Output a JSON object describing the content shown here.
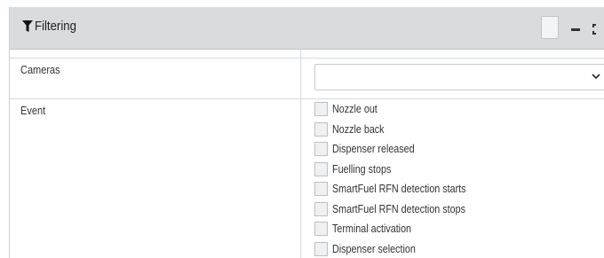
{
  "panel": {
    "title": "Filtering",
    "icons": {
      "title": "filter-funnel-icon",
      "restore": "restore-window-icon",
      "minimize": "minimize-icon",
      "maximize": "maximize-icon"
    }
  },
  "filters": {
    "cameras": {
      "label": "Cameras",
      "value": "",
      "dropdown_icon": "chevron-down-icon"
    },
    "event": {
      "label": "Event",
      "options": [
        {
          "label": "Nozzle out",
          "checked": false
        },
        {
          "label": "Nozzle back",
          "checked": false
        },
        {
          "label": "Dispenser released",
          "checked": false
        },
        {
          "label": "Fuelling stops",
          "checked": false
        },
        {
          "label": "SmartFuel RFN detection starts",
          "checked": false
        },
        {
          "label": "SmartFuel RFN detection stops",
          "checked": false
        },
        {
          "label": "Terminal activation",
          "checked": false
        },
        {
          "label": "Dispenser selection",
          "checked": false
        }
      ]
    }
  },
  "colors": {
    "header_bg": "#d8dcdf",
    "border": "#d6d9dc",
    "checkbox_bg": "#eef0f1"
  }
}
